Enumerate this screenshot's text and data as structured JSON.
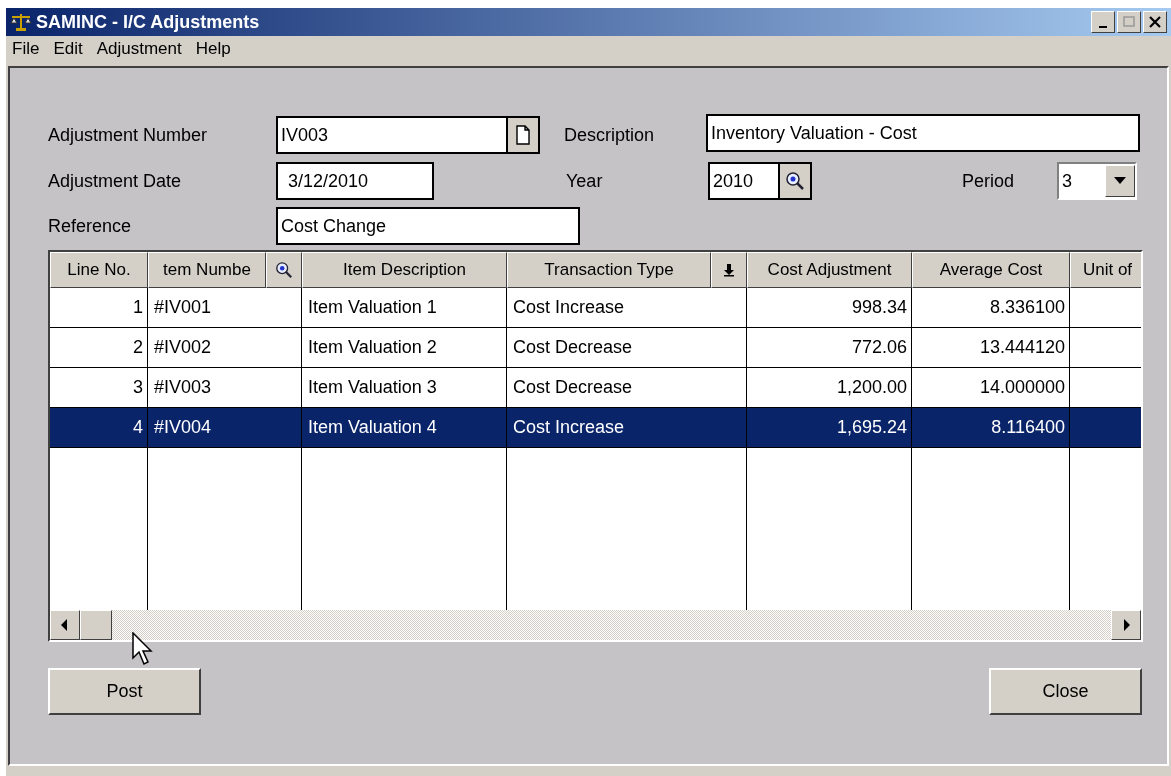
{
  "window": {
    "title": "SAMINC - I/C Adjustments"
  },
  "menu": [
    "File",
    "Edit",
    "Adjustment",
    "Help"
  ],
  "form": {
    "adjustment_number": {
      "label": "Adjustment Number",
      "value": "IV003"
    },
    "description": {
      "label": "Description",
      "value": "Inventory Valuation - Cost"
    },
    "adjustment_date": {
      "label": "Adjustment Date",
      "value": "3/12/2010"
    },
    "year": {
      "label": "Year",
      "value": "2010"
    },
    "period": {
      "label": "Period",
      "value": "3"
    },
    "reference": {
      "label": "Reference",
      "value": "Cost Change"
    }
  },
  "table": {
    "columns": [
      {
        "label": "Line No.",
        "kind": "number"
      },
      {
        "label": "tem Numbe",
        "kind": "lookup"
      },
      {
        "label": "Item Description",
        "kind": "text"
      },
      {
        "label": "Transaction Type",
        "kind": "dropdown"
      },
      {
        "label": "Cost Adjustment",
        "kind": "number"
      },
      {
        "label": "Average Cost",
        "kind": "number"
      },
      {
        "label": "Unit of",
        "kind": "text"
      }
    ],
    "rows": [
      {
        "cells": [
          "1",
          "#IV001",
          "Item Valuation 1",
          "Cost Increase",
          "998.34",
          "8.336100"
        ],
        "selected": false
      },
      {
        "cells": [
          "2",
          "#IV002",
          "Item Valuation 2",
          "Cost Decrease",
          "772.06",
          "13.444120"
        ],
        "selected": false
      },
      {
        "cells": [
          "3",
          "#IV003",
          "Item Valuation 3",
          "Cost Decrease",
          "1,200.00",
          "14.000000"
        ],
        "selected": false
      },
      {
        "cells": [
          "4",
          "#IV004",
          "Item Valuation 4",
          "Cost Increase",
          "1,695.24",
          "8.116400"
        ],
        "selected": true
      }
    ]
  },
  "buttons": [
    {
      "label": "Post"
    },
    {
      "label": "Close"
    }
  ]
}
